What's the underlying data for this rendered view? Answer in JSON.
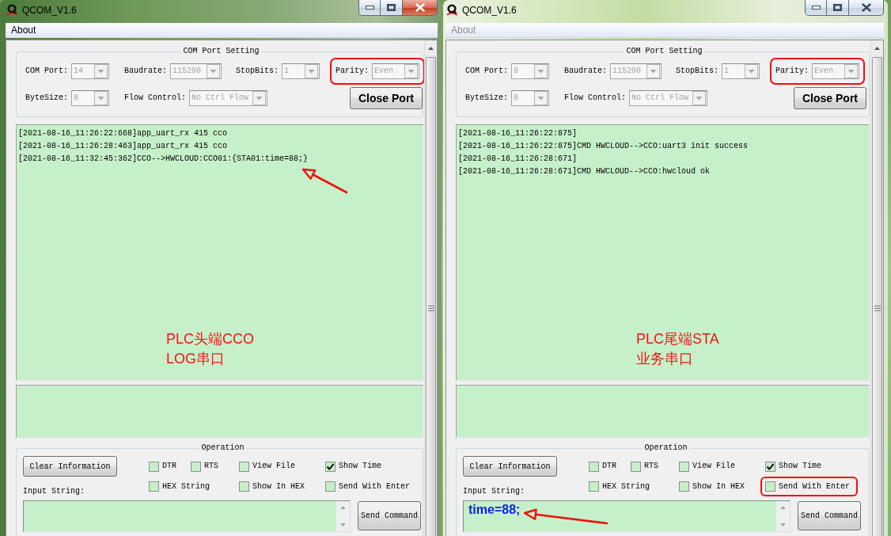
{
  "windows": [
    {
      "title": "QCOM_V1.6",
      "focused": true,
      "menu": [
        {
          "label": "About"
        }
      ],
      "port_setting": {
        "title": "COM Port Setting",
        "fields": [
          {
            "label": "COM Port:",
            "value": "14",
            "disabled": true,
            "highlighted": false
          },
          {
            "label": "Baudrate:",
            "value": "115200",
            "disabled": true,
            "highlighted": false
          },
          {
            "label": "StopBits:",
            "value": "1",
            "disabled": true,
            "highlighted": false
          },
          {
            "label": "Parity:",
            "value": "Even",
            "disabled": true,
            "highlighted": true
          },
          {
            "label": "ByteSize:",
            "value": "8",
            "disabled": true,
            "highlighted": false
          },
          {
            "label": "Flow Control:",
            "value": "No Ctrl Flow",
            "disabled": true,
            "highlighted": false
          }
        ],
        "button": "Close Port"
      },
      "receive_log": {
        "lines": [
          {
            "text": "[2021-08-16_11:26:22:668]app_uart_rx 415 cco",
            "arrow": false
          },
          {
            "text": "[2021-08-16_11:26:28:463]app_uart_rx 415 cco",
            "arrow": false
          },
          {
            "text": "[2021-08-16_11:32:45:362]CCO-->HWCLOUD:CCO01:{STA01:time=88;}",
            "arrow": true
          }
        ],
        "annotation": [
          "PLC头端CCO",
          "LOG串口"
        ]
      },
      "operation": {
        "title": "Operation",
        "clear_button": "Clear Information",
        "checkboxes": [
          {
            "label": "DTR",
            "checked": false,
            "highlighted": false
          },
          {
            "label": "RTS",
            "checked": false,
            "highlighted": false
          },
          {
            "label": "View File",
            "checked": false,
            "highlighted": false
          },
          {
            "label": "Show Time",
            "checked": true,
            "highlighted": false
          },
          {
            "label": "HEX String",
            "checked": false,
            "highlighted": false
          },
          {
            "label": "Show In HEX",
            "checked": false,
            "highlighted": false
          },
          {
            "label": "Send With Enter",
            "checked": false,
            "highlighted": false
          }
        ],
        "input_label": "Input String:",
        "input": {
          "arrow": false
        },
        "send_button": "Send Command"
      }
    },
    {
      "title": "QCOM_V1.6",
      "focused": false,
      "menu": [
        {
          "label": "About"
        }
      ],
      "port_setting": {
        "title": "COM Port Setting",
        "fields": [
          {
            "label": "COM Port:",
            "value": "8",
            "disabled": true,
            "highlighted": false
          },
          {
            "label": "Baudrate:",
            "value": "115200",
            "disabled": true,
            "highlighted": false
          },
          {
            "label": "StopBits:",
            "value": "1",
            "disabled": true,
            "highlighted": false
          },
          {
            "label": "Parity:",
            "value": "Even",
            "disabled": true,
            "highlighted": true
          },
          {
            "label": "ByteSize:",
            "value": "8",
            "disabled": true,
            "highlighted": false
          },
          {
            "label": "Flow Control:",
            "value": "No Ctrl Flow",
            "disabled": true,
            "highlighted": false
          }
        ],
        "button": "Close Port"
      },
      "receive_log": {
        "lines": [
          {
            "text": "[2021-08-16_11:26:22:875]",
            "arrow": false
          },
          {
            "text": "[2021-08-16_11:26:22:875]CMD HWCLOUD-->CCO:uart3 init success",
            "arrow": false
          },
          {
            "text": "[2021-08-16_11:26:28:671]",
            "arrow": false
          },
          {
            "text": "[2021-08-16_11:26:28:671]CMD HWCLOUD-->CCO:hwcloud ok",
            "arrow": false
          }
        ],
        "annotation": [
          "PLC尾端STA",
          "业务串口"
        ]
      },
      "operation": {
        "title": "Operation",
        "clear_button": "Clear Information",
        "checkboxes": [
          {
            "label": "DTR",
            "checked": false,
            "highlighted": false
          },
          {
            "label": "RTS",
            "checked": false,
            "highlighted": false
          },
          {
            "label": "View File",
            "checked": false,
            "highlighted": false
          },
          {
            "label": "Show Time",
            "checked": true,
            "highlighted": false
          },
          {
            "label": "HEX String",
            "checked": false,
            "highlighted": false
          },
          {
            "label": "Show In HEX",
            "checked": false,
            "highlighted": false
          },
          {
            "label": "Send With Enter",
            "checked": false,
            "highlighted": true
          }
        ],
        "input_label": "Input String:",
        "input": {
          "value": "time=88;",
          "arrow": true
        },
        "send_button": "Send Command"
      }
    }
  ]
}
